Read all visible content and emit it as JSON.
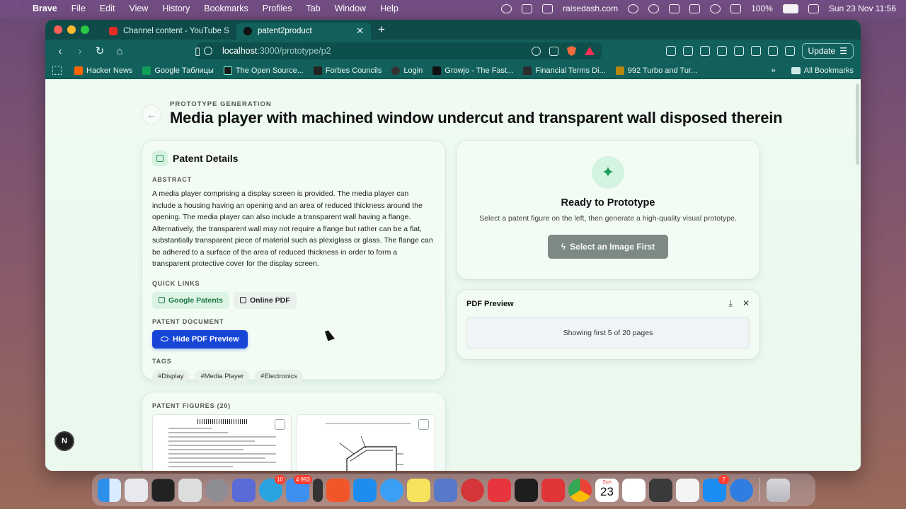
{
  "menubar": {
    "app": "Brave",
    "items": [
      "File",
      "Edit",
      "View",
      "History",
      "Bookmarks",
      "Profiles",
      "Tab",
      "Window",
      "Help"
    ],
    "tray_host": "raisedash.com",
    "battery": "100%",
    "clock": "Sun 23 Nov  11:56"
  },
  "browser": {
    "tabs": [
      {
        "title": "Channel content - YouTube Studio"
      },
      {
        "title": "patent2product"
      }
    ],
    "url_host": "localhost",
    "url_path": ":3000/prototype/p2",
    "update_label": "Update",
    "bookmarks": [
      {
        "label": "Hacker News",
        "color": "#ff6600"
      },
      {
        "label": "Google Таблицы",
        "color": "#0f9d58"
      },
      {
        "label": "The Open Source...",
        "color": "#1a1a1a"
      },
      {
        "label": "Forbes Councils",
        "color": "#222222"
      },
      {
        "label": "Login",
        "color": "#333333"
      },
      {
        "label": "Growjo - The Fast...",
        "color": "#111111"
      },
      {
        "label": "Financial Terms Di...",
        "color": "#2b2b2b"
      },
      {
        "label": "992 Turbo and Tur...",
        "color": "#b8860b"
      }
    ],
    "all_bookmarks": "All Bookmarks"
  },
  "page": {
    "eyebrow": "PROTOTYPE GENERATION",
    "title": "Media player with machined window undercut and transparent wall disposed therein",
    "details": {
      "title": "Patent Details",
      "abstract_label": "ABSTRACT",
      "abstract": "A media player comprising a display screen is provided. The media player can include a housing having an opening and an area of reduced thickness around the opening. The media player can also include a transparent wall having a flange. Alternatively, the transparent wall may not require a flange but rather can be a flat, substantially transparent piece of material such as plexiglass or glass. The flange can be adhered to a surface of the area of reduced thickness in order to form a transparent protective cover for the display screen.",
      "quick_links_label": "QUICK LINKS",
      "google_patents": "Google Patents",
      "online_pdf": "Online PDF",
      "document_label": "PATENT DOCUMENT",
      "hide_pdf": "Hide PDF Preview",
      "tags_label": "TAGS",
      "tags": [
        "#Display",
        "#Media Player",
        "#Electronics"
      ]
    },
    "figures": {
      "label": "PATENT FIGURES (20)"
    },
    "ready": {
      "title": "Ready to Prototype",
      "subtitle": "Select a patent figure on the left, then generate a high-quality visual prototype.",
      "button": "Select an Image First"
    },
    "pdf": {
      "title": "PDF Preview",
      "status": "Showing first 5 of 20 pages"
    },
    "badge": "N"
  },
  "dock": {
    "calendar_month": "Sun",
    "calendar_day": "23",
    "telegram_badge": "10",
    "mail_badge": "4 993",
    "appstore_badge": "7"
  }
}
